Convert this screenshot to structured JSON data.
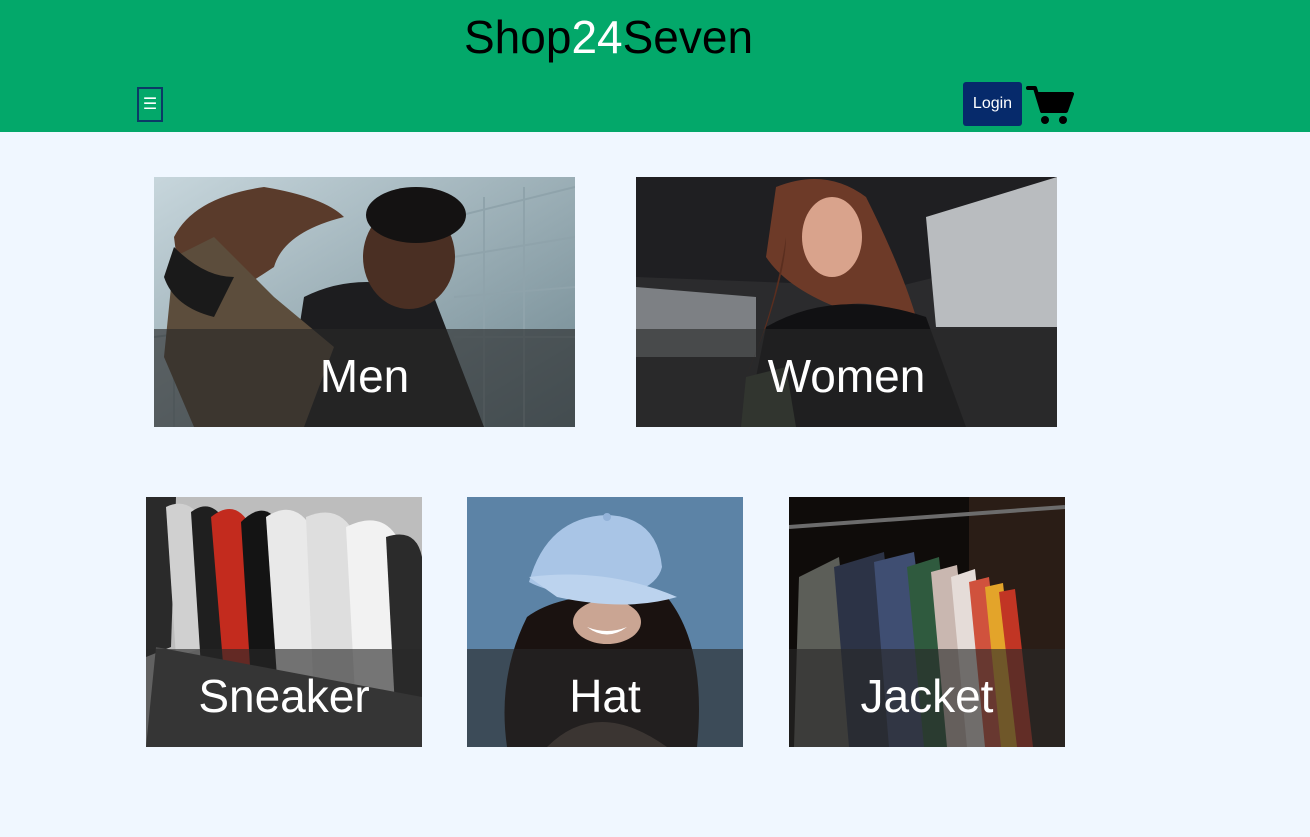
{
  "header": {
    "logo_prefix": "Shop",
    "logo_accent": "24",
    "logo_suffix": "Seven",
    "menu_icon": "☰",
    "login_label": "Login",
    "cart_icon": "cart-icon"
  },
  "categories": [
    {
      "label": "Men"
    },
    {
      "label": "Women"
    },
    {
      "label": "Sneaker"
    },
    {
      "label": "Hat"
    },
    {
      "label": "Jacket"
    }
  ],
  "colors": {
    "header_bg": "#03a86a",
    "page_bg": "#f0f7ff",
    "login_bg": "#062a6b",
    "caption_overlay": "rgba(40,40,40,0.62)"
  }
}
